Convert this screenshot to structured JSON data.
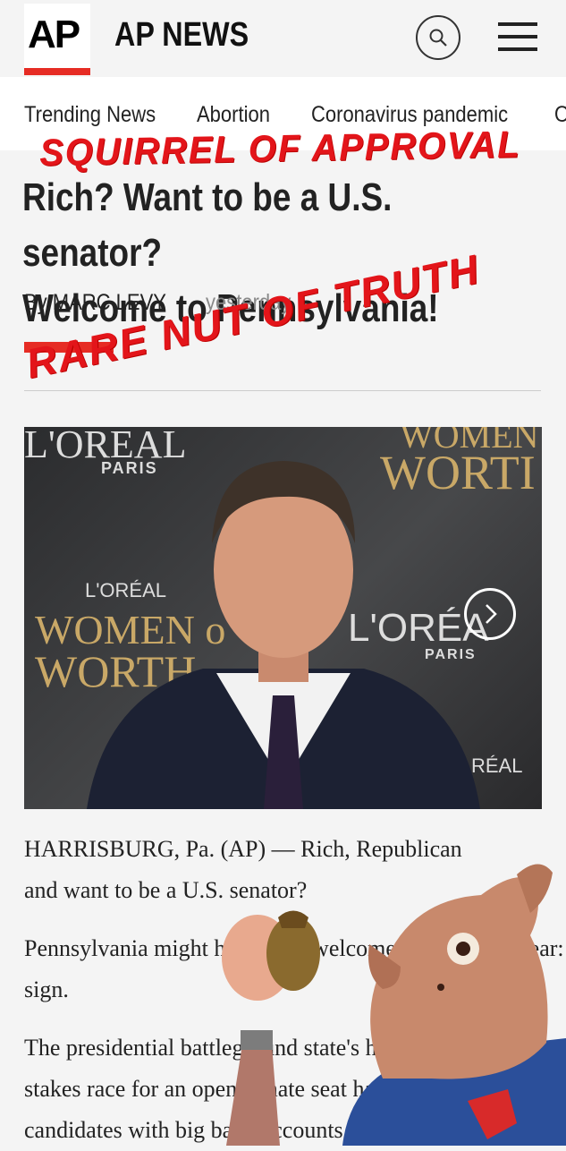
{
  "header": {
    "logo_text": "AP",
    "brand": "AP NEWS",
    "search_icon": "search-icon",
    "menu_icon": "hamburger-menu-icon"
  },
  "trending": [
    "Trending News",
    "Abortion",
    "Coronavirus pandemic",
    "O"
  ],
  "article": {
    "headline_line1": "Rich? Want to be a U.S. senator?",
    "headline_line2": "Welcome to Pennsylvania!",
    "byline": "By MARC LEVY",
    "time": "yesterday"
  },
  "overlay": {
    "stamp_top": "SQUIRREL OF APPROVAL",
    "stamp_mid": "RARE NUT OF TRUTH"
  },
  "photo": {
    "text1": "L'OREAL",
    "text2": "PARIS",
    "text3": "WOMEN",
    "text4": "WORTI",
    "text5": "L'ORÉAL",
    "text6": "WOMEN o",
    "text7": "WORTH",
    "text8": "L'ORÉA",
    "text9": "PARIS",
    "text10": "RÉAL",
    "next_icon": "chevron-right-icon"
  },
  "paragraphs": {
    "p1_line1": "HARRISBURG, Pa. (AP) — Rich, Republican",
    "p1_line2": "and want to be a U.S. senator?",
    "p2_line1": "Pennsylvania might have your welcome mat out this year:",
    "p2_line2": "sign.",
    "p3_line1": "The presidential battleground state's high-",
    "p3_line2": "stakes race for an open Senate seat has",
    "p3_line3": "candidates with big bank accounts."
  },
  "colors": {
    "accent": "#e62c24",
    "stamp": "#e3151a"
  }
}
